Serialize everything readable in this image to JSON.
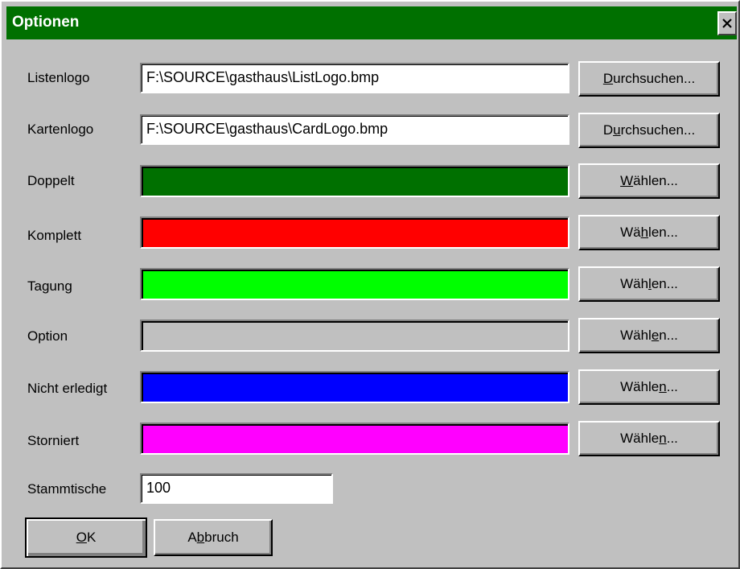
{
  "window": {
    "title": "Optionen"
  },
  "fields": {
    "listenlogo": {
      "label": "Listenlogo",
      "value": "F:\\SOURCE\\gasthaus\\ListLogo.bmp",
      "button": [
        "",
        "D",
        "urchsuchen..."
      ]
    },
    "kartenlogo": {
      "label": "Kartenlogo",
      "value": "F:\\SOURCE\\gasthaus\\CardLogo.bmp",
      "button": [
        "D",
        "u",
        "rchsuchen..."
      ]
    }
  },
  "colors": [
    {
      "label": "Doppelt",
      "color": "#007000",
      "button": [
        "",
        "W",
        "ählen..."
      ]
    },
    {
      "label": "Komplett",
      "color": "#ff0000",
      "button": [
        "Wä",
        "h",
        "len..."
      ]
    },
    {
      "label": "Tagung",
      "color": "#00ff00",
      "button": [
        "Wäh",
        "l",
        "en..."
      ]
    },
    {
      "label": "Option",
      "color": "#c0c0c0",
      "button": [
        "Wähl",
        "e",
        "n..."
      ]
    },
    {
      "label": "Nicht erledigt",
      "color": "#0000ff",
      "button": [
        "Wähle",
        "n",
        "..."
      ]
    },
    {
      "label": "Storniert",
      "color": "#ff00ff",
      "button": [
        "Wähle",
        "n",
        "..."
      ]
    }
  ],
  "stammtische": {
    "label": "Stammtische",
    "value": "100"
  },
  "actions": {
    "ok": [
      "",
      "O",
      "K"
    ],
    "cancel": [
      "A",
      "b",
      "bruch"
    ]
  }
}
